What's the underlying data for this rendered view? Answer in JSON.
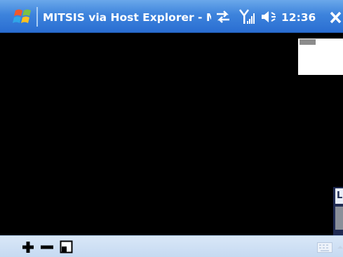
{
  "titlebar": {
    "title": "MITSIS via Host Explorer - M",
    "clock": "12:36",
    "colors": {
      "bar": "#3d83dc",
      "text": "#ffffff"
    },
    "icons": [
      "windows-start-icon",
      "connectivity-icon",
      "signal-strength-icon",
      "volume-icon",
      "close-icon"
    ]
  },
  "terminal": {
    "background": "#000000",
    "side_window_label": "L"
  },
  "toolbar": {
    "icons": [
      "plus-icon",
      "minus-icon",
      "window-icon",
      "keyboard-icon",
      "input-arrow-icon"
    ]
  }
}
